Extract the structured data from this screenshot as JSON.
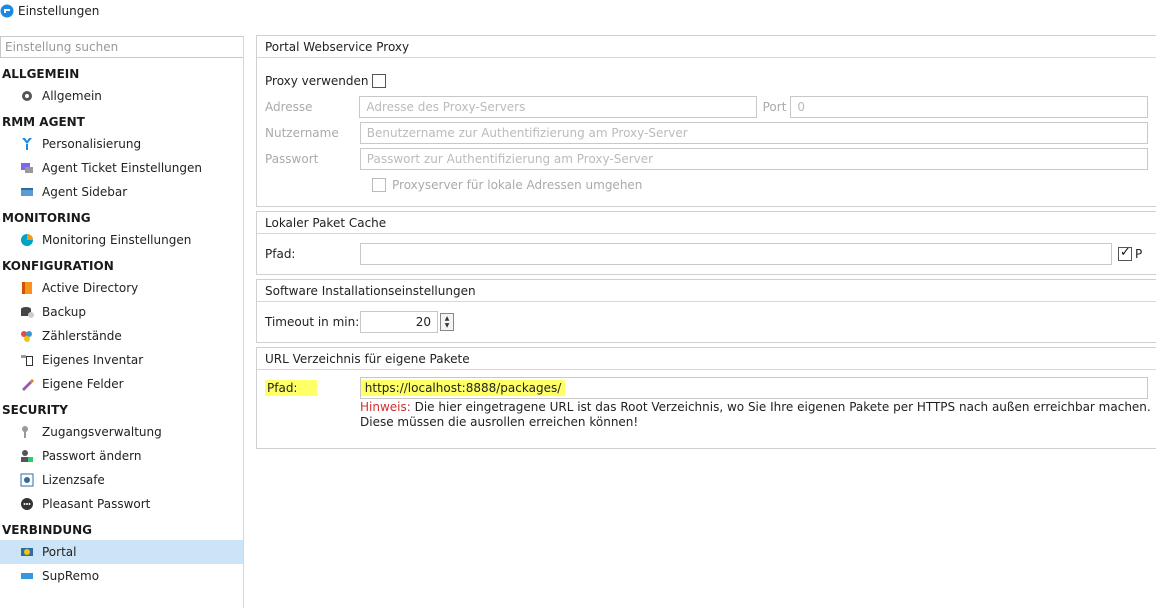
{
  "window": {
    "title": "Einstellungen"
  },
  "sidebar": {
    "search_placeholder": "Einstellung suchen",
    "sections": [
      {
        "title": "ALLGEMEIN",
        "items": [
          {
            "label": "Allgemein",
            "icon": "gear-icon"
          }
        ]
      },
      {
        "title": "RMM AGENT",
        "items": [
          {
            "label": "Personalisierung",
            "icon": "brush-icon"
          },
          {
            "label": "Agent Ticket Einstellungen",
            "icon": "ticket-icon"
          },
          {
            "label": "Agent Sidebar",
            "icon": "sidebar-icon"
          }
        ]
      },
      {
        "title": "MONITORING",
        "items": [
          {
            "label": "Monitoring Einstellungen",
            "icon": "pie-chart-icon"
          }
        ]
      },
      {
        "title": "KONFIGURATION",
        "items": [
          {
            "label": "Active Directory",
            "icon": "directory-icon"
          },
          {
            "label": "Backup",
            "icon": "backup-icon"
          },
          {
            "label": "Zählerstände",
            "icon": "counter-icon"
          },
          {
            "label": "Eigenes Inventar",
            "icon": "inventory-icon"
          },
          {
            "label": "Eigene Felder",
            "icon": "pen-icon"
          }
        ]
      },
      {
        "title": "SECURITY",
        "items": [
          {
            "label": "Zugangsverwaltung",
            "icon": "key-icon"
          },
          {
            "label": "Passwort ändern",
            "icon": "user-lock-icon"
          },
          {
            "label": "Lizenzsafe",
            "icon": "safe-icon"
          },
          {
            "label": "Pleasant Passwort",
            "icon": "pleasant-icon"
          }
        ]
      },
      {
        "title": "VERBINDUNG",
        "items": [
          {
            "label": "Portal",
            "icon": "portal-icon",
            "active": true
          },
          {
            "label": "SupRemo",
            "icon": "remote-icon"
          }
        ]
      }
    ]
  },
  "proxy": {
    "header": "Portal Webservice Proxy",
    "use_label": "Proxy verwenden",
    "address_label": "Adresse",
    "address_placeholder": "Adresse des Proxy-Servers",
    "port_label": "Port",
    "port_value": "0",
    "user_label": "Nutzername",
    "user_placeholder": "Benutzername zur Authentifizierung am Proxy-Server",
    "pass_label": "Passwort",
    "pass_placeholder": "Passwort zur Authentifizierung am Proxy-Server",
    "bypass_label": "Proxyserver für lokale Adressen umgehen"
  },
  "cache": {
    "header": "Lokaler Paket Cache",
    "path_label": "Pfad:",
    "path_value": "",
    "check_label": "P"
  },
  "install": {
    "header": "Software Installationseinstellungen",
    "timeout_label": "Timeout in min:",
    "timeout_value": "20"
  },
  "urlrepo": {
    "header": "URL Verzeichnis für eigene Pakete",
    "path_label": "Pfad:",
    "path_value": "https://localhost:8888/packages/",
    "hint_prefix": "Hinweis:",
    "hint_text": " Die hier eingetragene URL ist das Root Verzeichnis, wo Sie Ihre eigenen Pakete per HTTPS nach außen erreichbar machen. Diese müssen die ausrollen erreichen können!"
  },
  "colors": {
    "active_item": "#cce4f7",
    "highlight": "#ffff66",
    "warning": "#d13030"
  }
}
